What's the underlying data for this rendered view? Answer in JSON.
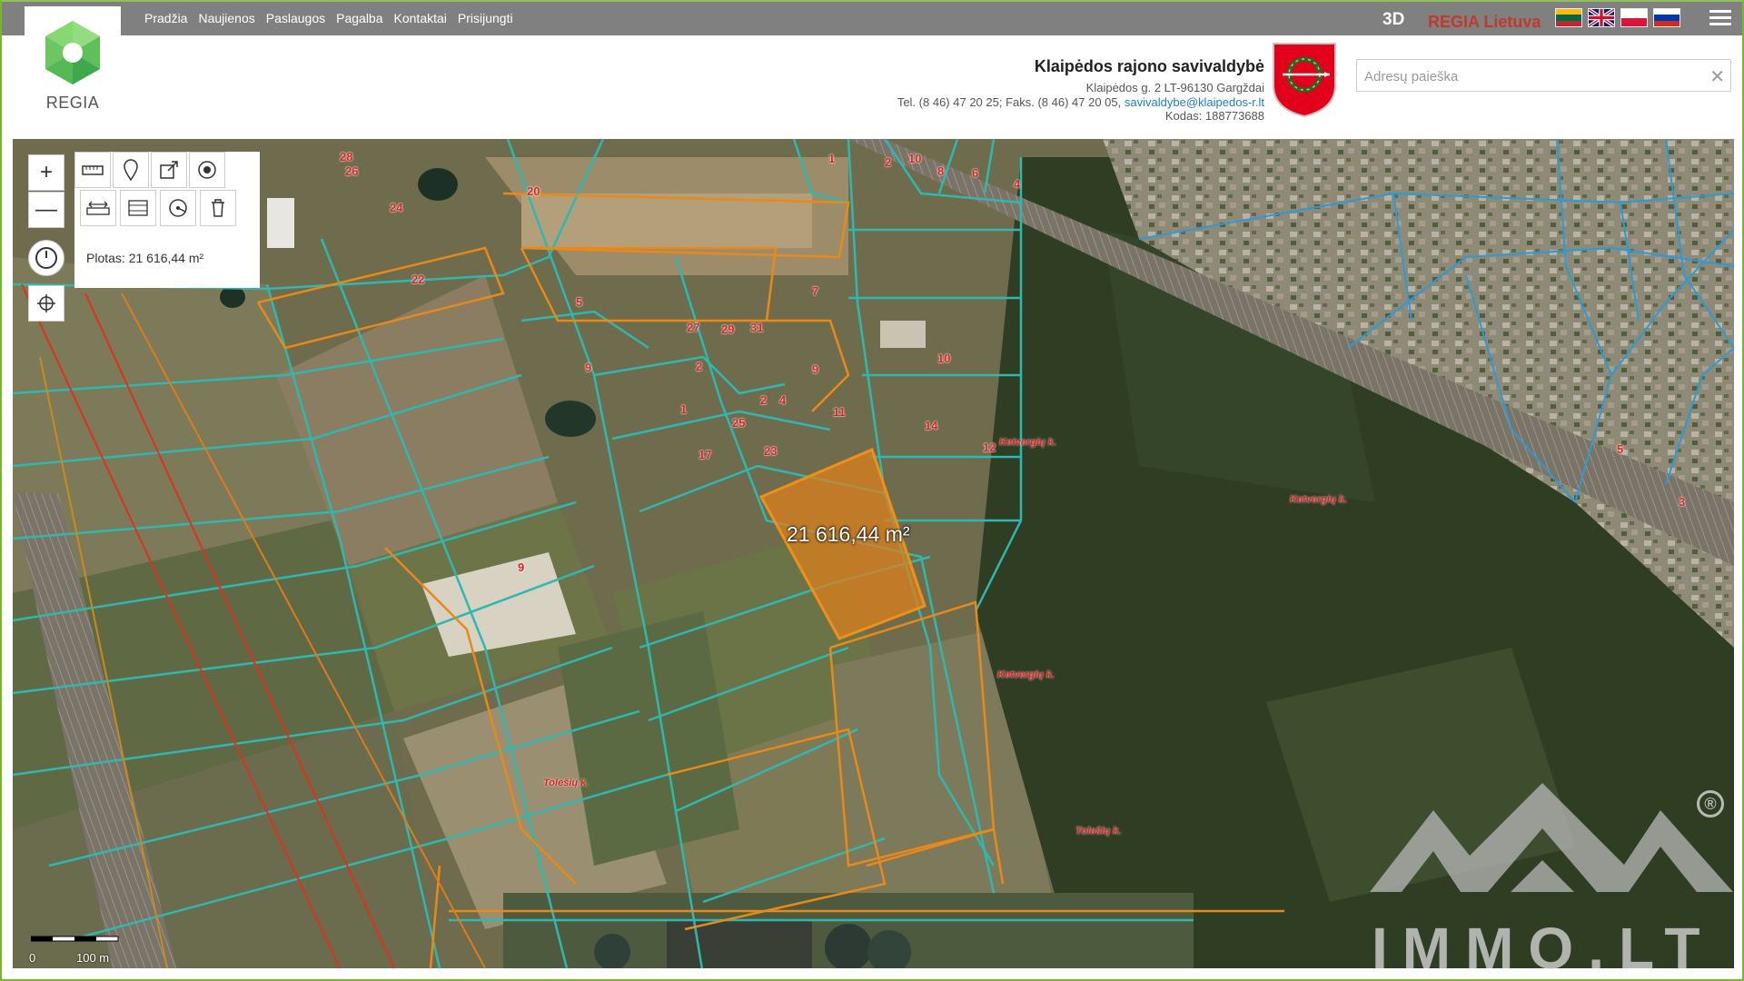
{
  "logo": {
    "text": "REGIA"
  },
  "nav": {
    "items": [
      {
        "label": "Pradžia"
      },
      {
        "label": "Naujienos"
      },
      {
        "label": "Paslaugos"
      },
      {
        "label": "Pagalba"
      },
      {
        "label": "Kontaktai"
      },
      {
        "label": "Prisijungti"
      }
    ]
  },
  "topbar": {
    "mode_3d": "3D",
    "regia_country": "REGIA Lietuva",
    "flags": [
      "lt-flag-icon",
      "gb-flag-icon",
      "pl-flag-icon",
      "ru-flag-icon"
    ],
    "menu_icon": "hamburger-icon"
  },
  "municipality": {
    "title": "Klaipėdos rajono savivaldybė",
    "address": "Klaipėdos g. 2 LT-96130 Gargždai",
    "phone_fax": "Tel. (8 46) 47 20 25; Faks. (8 46) 47 20 05,",
    "email": "savivaldybe@klaipedos-r.lt",
    "code": "Kodas: 188773688"
  },
  "search": {
    "placeholder": "Adresų paieška",
    "value": ""
  },
  "map": {
    "tools": {
      "zoom_in": "+",
      "zoom_out": "—",
      "area_label": "Plotas: 21 616,44 m²"
    },
    "selected_area_text": "21 616,44 m²",
    "parcel_numbers": [
      "24",
      "20",
      "28",
      "26",
      "22",
      "5",
      "9",
      "27",
      "29",
      "31",
      "2",
      "9",
      "10",
      "1",
      "2",
      "4",
      "25",
      "11",
      "14",
      "17",
      "23",
      "12",
      "1",
      "2",
      "10",
      "8",
      "6",
      "4",
      "7",
      "9",
      "5",
      "3"
    ],
    "place_names": [
      "Ketvergių k.",
      "Ketvergių k.",
      "Ketvergių k.",
      "Tolešių k.",
      "Tolešių k."
    ],
    "scale": {
      "start": "0",
      "end": "100 m"
    }
  },
  "watermark": {
    "text": "IMMO.LT",
    "registered": "®"
  },
  "colors": {
    "accent_green": "#76b82a",
    "topbar": "#808080",
    "parcel_line": "#2fb8b0",
    "selected_parcel": "#e8891a",
    "regia_red": "#c0392b"
  }
}
